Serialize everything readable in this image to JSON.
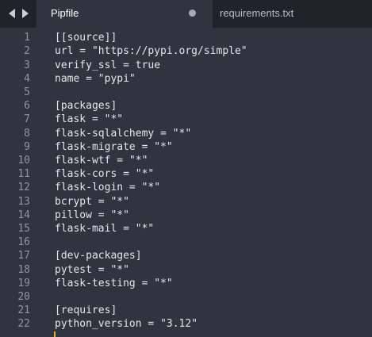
{
  "tabs": [
    {
      "label": "Pipfile",
      "active": true,
      "unsaved": true
    },
    {
      "label": "requirements.txt",
      "active": false,
      "unsaved": false
    }
  ],
  "nav": {
    "back_icon": "triangle-left",
    "forward_icon": "triangle-right"
  },
  "editor": {
    "lines": [
      {
        "number": "1",
        "text": "[[source]]"
      },
      {
        "number": "2",
        "text": "url = \"https://pypi.org/simple\""
      },
      {
        "number": "3",
        "text": "verify_ssl = true"
      },
      {
        "number": "4",
        "text": "name = \"pypi\""
      },
      {
        "number": "5",
        "text": ""
      },
      {
        "number": "6",
        "text": "[packages]"
      },
      {
        "number": "7",
        "text": "flask = \"*\""
      },
      {
        "number": "8",
        "text": "flask-sqlalchemy = \"*\""
      },
      {
        "number": "9",
        "text": "flask-migrate = \"*\""
      },
      {
        "number": "10",
        "text": "flask-wtf = \"*\""
      },
      {
        "number": "11",
        "text": "flask-cors = \"*\""
      },
      {
        "number": "12",
        "text": "flask-login = \"*\""
      },
      {
        "number": "13",
        "text": "bcrypt = \"*\""
      },
      {
        "number": "14",
        "text": "pillow = \"*\""
      },
      {
        "number": "15",
        "text": "flask-mail = \"*\""
      },
      {
        "number": "16",
        "text": ""
      },
      {
        "number": "17",
        "text": "[dev-packages]"
      },
      {
        "number": "18",
        "text": "pytest = \"*\""
      },
      {
        "number": "19",
        "text": "flask-testing = \"*\""
      },
      {
        "number": "20",
        "text": ""
      },
      {
        "number": "21",
        "text": "[requires]"
      },
      {
        "number": "22",
        "text": "python_version = \"3.12\""
      }
    ]
  },
  "colors": {
    "editor_background": "#2f353f",
    "tabbar_background": "#1f232a",
    "text": "#e4e6ea",
    "line_number": "#8f96a1",
    "caret": "#f0a830"
  }
}
